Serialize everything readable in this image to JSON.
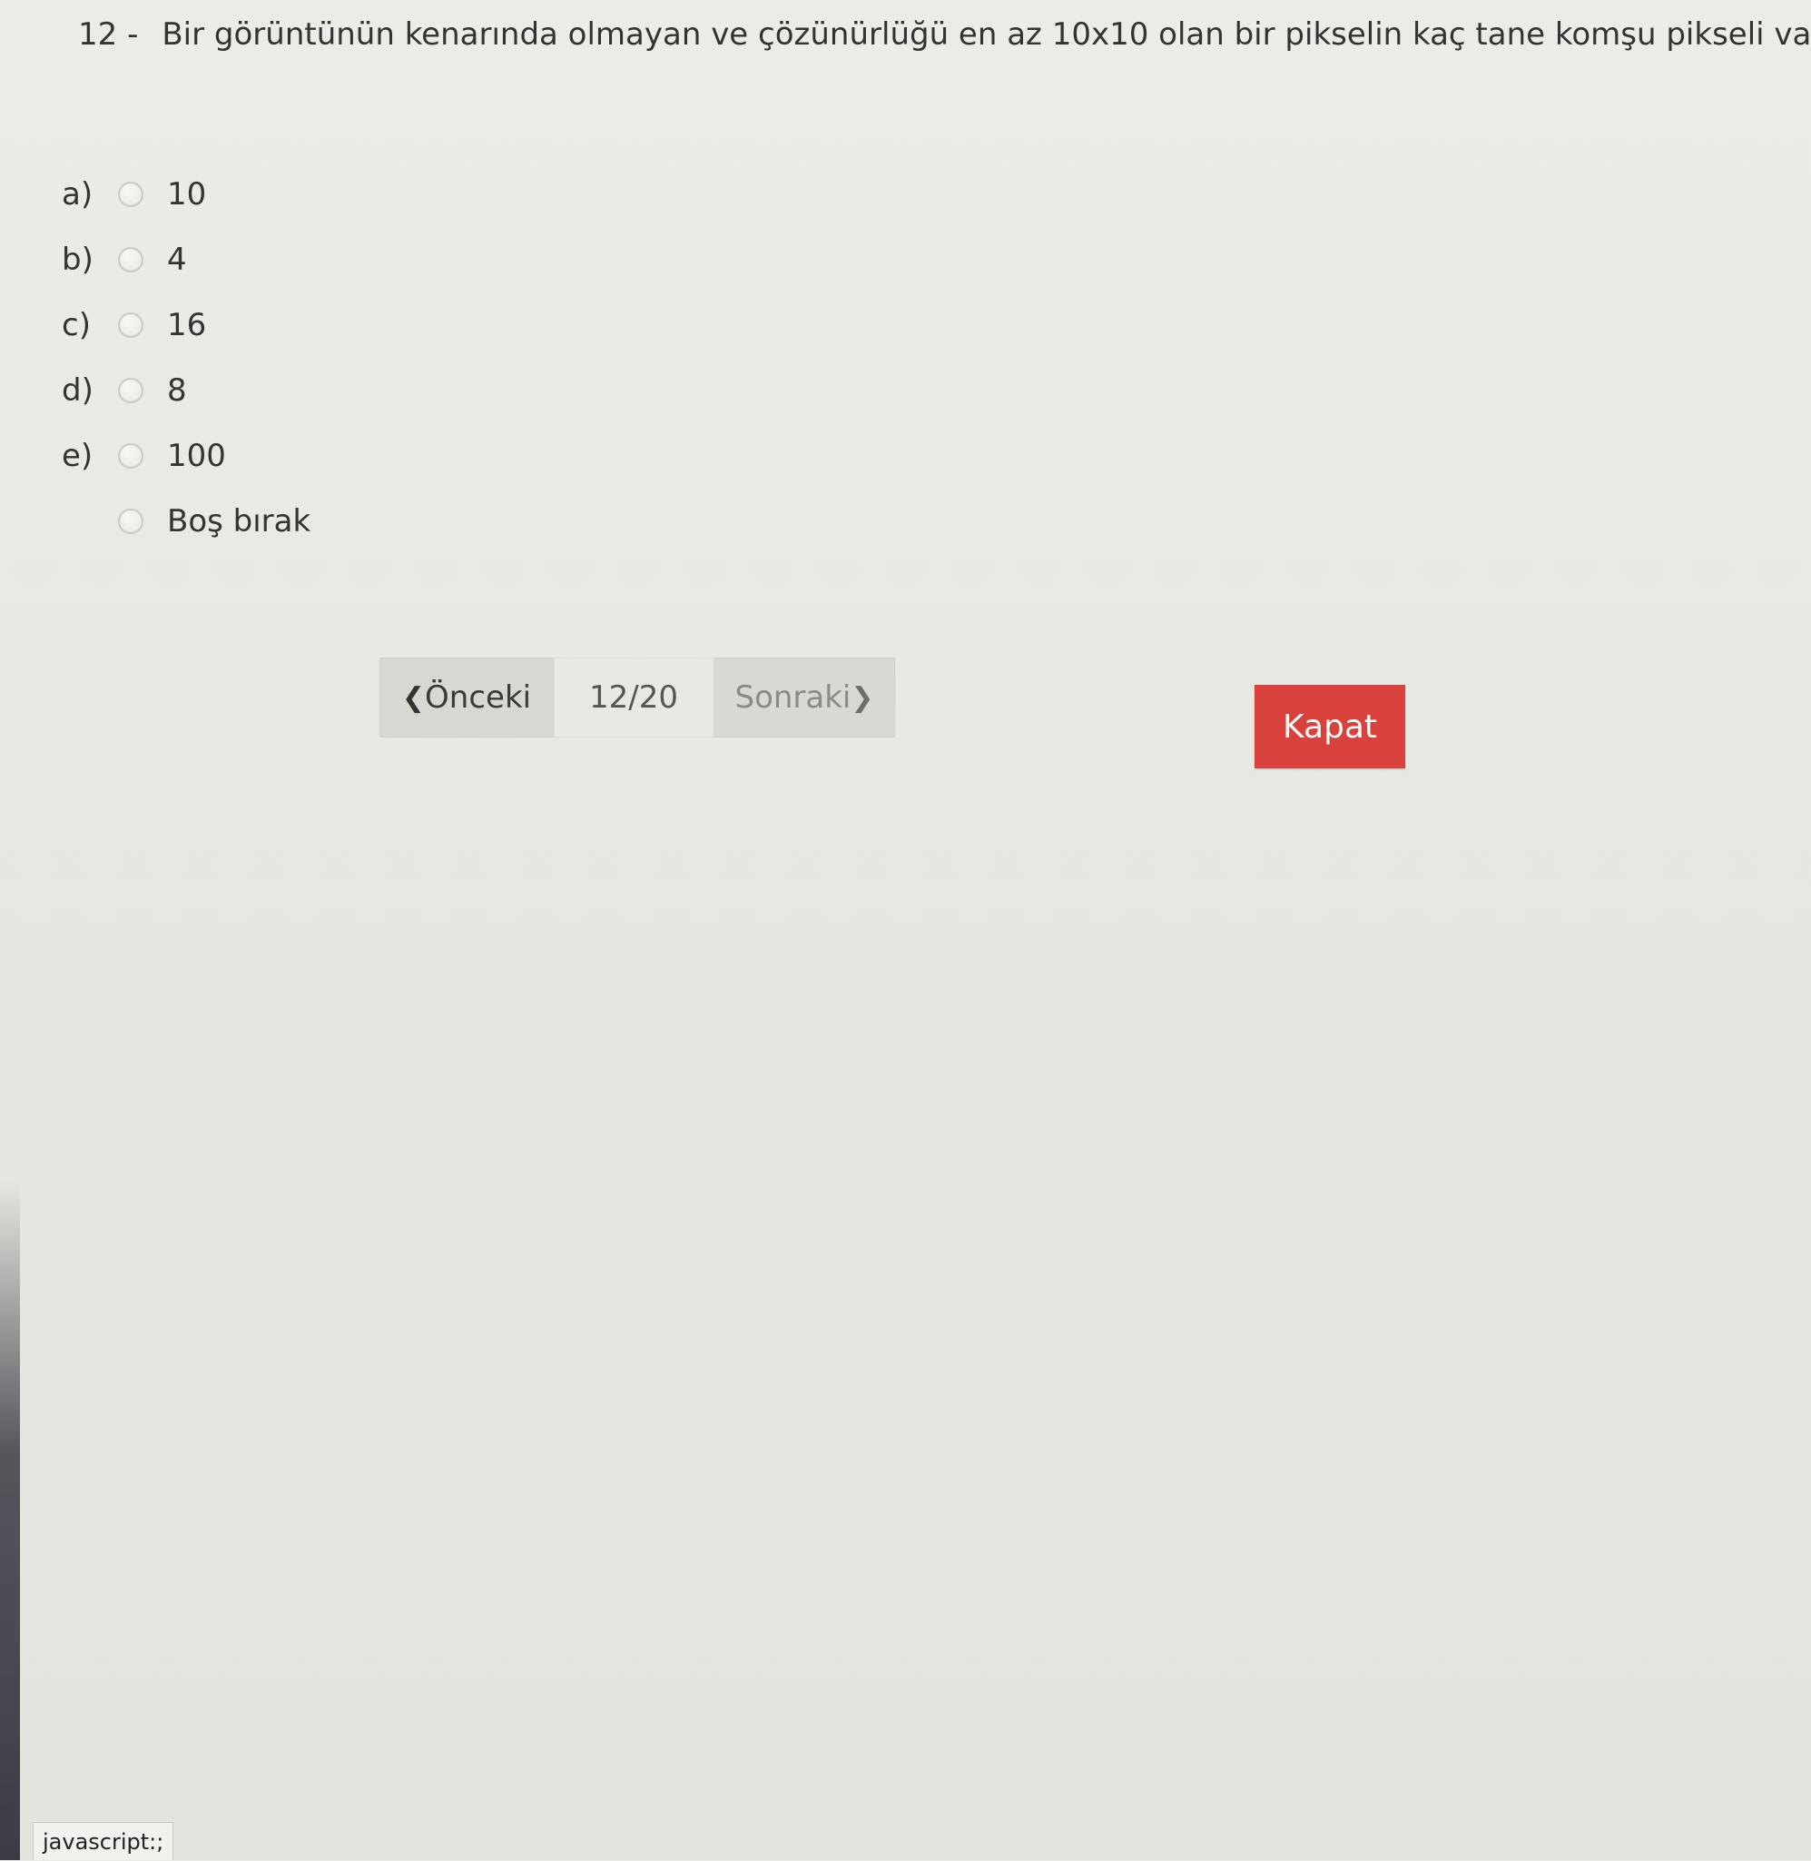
{
  "question": {
    "number": "12 -",
    "text": "Bir görüntünün kenarında olmayan ve çözünürlüğü en az 10x10 olan bir pikselin kaç tane komşu pikseli vardır?"
  },
  "options": [
    {
      "letter": "a)",
      "text": "10"
    },
    {
      "letter": "b)",
      "text": "4"
    },
    {
      "letter": "c)",
      "text": "16"
    },
    {
      "letter": "d)",
      "text": "8"
    },
    {
      "letter": "e)",
      "text": "100"
    }
  ],
  "skip_option": {
    "text": "Boş bırak"
  },
  "navigation": {
    "prev_label": "Önceki",
    "prev_icon": "chevron-left-icon",
    "counter": "12/20",
    "next_label": "Sonraki",
    "next_icon": "chevron-right-icon"
  },
  "close_button": {
    "label": "Kapat",
    "color": "#d9423c"
  },
  "status_bar": {
    "text": "javascript:;"
  }
}
